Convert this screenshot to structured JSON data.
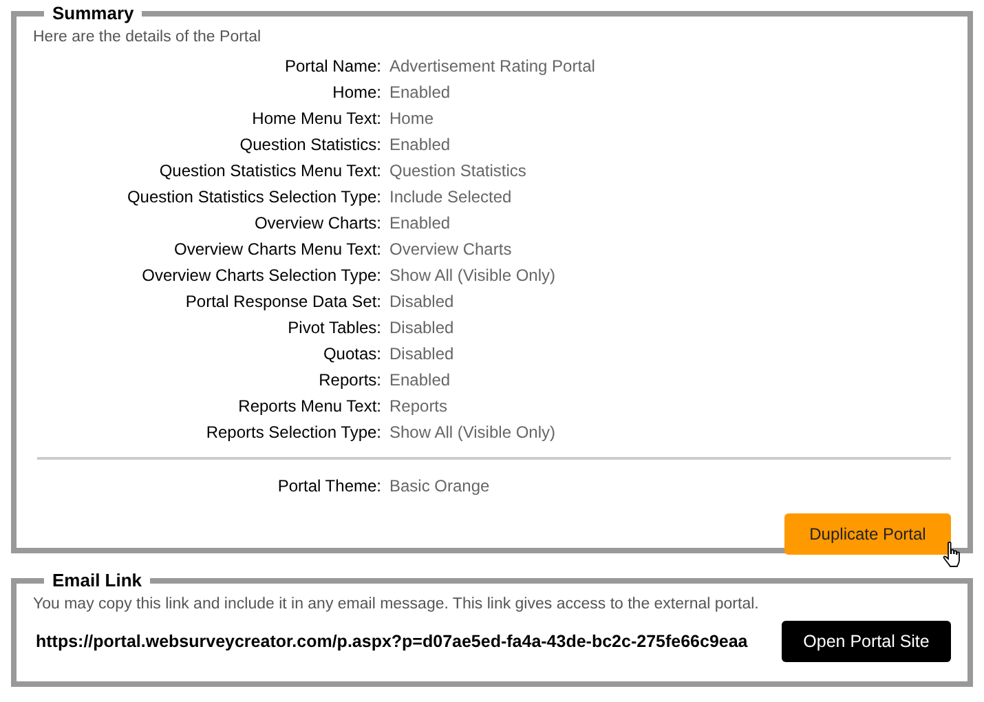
{
  "summary": {
    "legend": "Summary",
    "intro": "Here are the details of the Portal",
    "details": [
      {
        "label": "Portal Name:",
        "value": "Advertisement Rating Portal"
      },
      {
        "label": "Home:",
        "value": "Enabled"
      },
      {
        "label": "Home Menu Text:",
        "value": "Home"
      },
      {
        "label": "Question Statistics:",
        "value": "Enabled"
      },
      {
        "label": "Question Statistics Menu Text:",
        "value": "Question Statistics"
      },
      {
        "label": "Question Statistics Selection Type:",
        "value": "Include Selected"
      },
      {
        "label": "Overview Charts:",
        "value": "Enabled"
      },
      {
        "label": "Overview Charts Menu Text:",
        "value": "Overview Charts"
      },
      {
        "label": "Overview Charts Selection Type:",
        "value": "Show All (Visible Only)"
      },
      {
        "label": "Portal Response Data Set:",
        "value": "Disabled"
      },
      {
        "label": "Pivot Tables:",
        "value": "Disabled"
      },
      {
        "label": "Quotas:",
        "value": "Disabled"
      },
      {
        "label": "Reports:",
        "value": "Enabled"
      },
      {
        "label": "Reports Menu Text:",
        "value": "Reports"
      },
      {
        "label": "Reports Selection Type:",
        "value": "Show All (Visible Only)"
      }
    ],
    "theme": {
      "label": "Portal Theme:",
      "value": "Basic Orange"
    },
    "button": "Duplicate Portal"
  },
  "email_link": {
    "legend": "Email Link",
    "note": "You may copy this link and include it in any email message. This link gives access to the external portal.",
    "url": "https://portal.websurveycreator.com/p.aspx?p=d07ae5ed-fa4a-43de-bc2c-275fe66c9eaa",
    "button": "Open Portal Site"
  }
}
